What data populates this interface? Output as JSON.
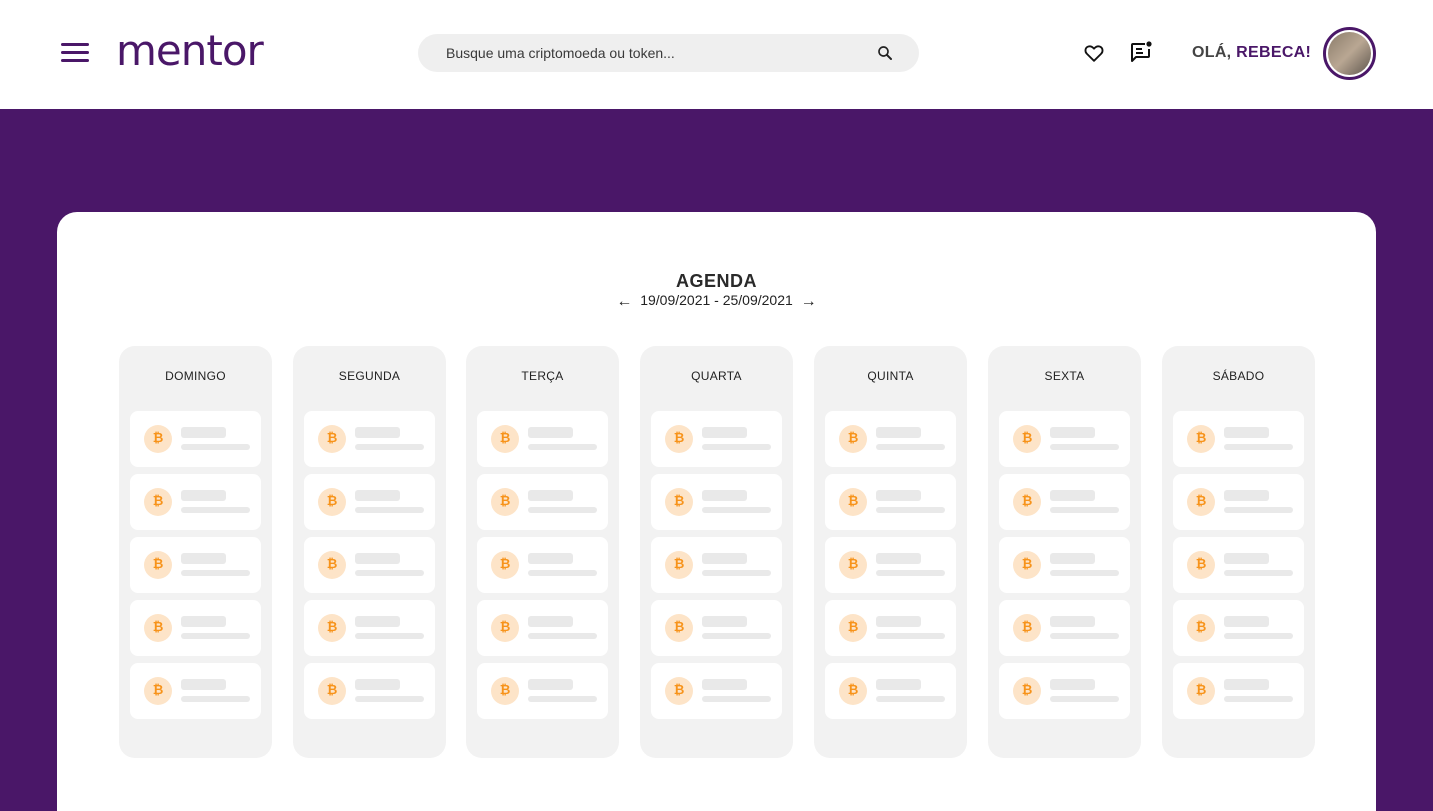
{
  "header": {
    "logo": "mentor",
    "search_placeholder": "Busque uma criptomoeda ou token...",
    "greeting_prefix": "OLÁ, ",
    "greeting_name": "REBECA!",
    "icons": [
      "menu-icon",
      "search-icon",
      "heart-icon",
      "chat-notification-icon"
    ]
  },
  "agenda": {
    "title": "AGENDA",
    "range": "19/09/2021 - 25/09/2021",
    "prev_arrow": "←",
    "next_arrow": "→",
    "days": [
      "DOMINGO",
      "SEGUNDA",
      "TERÇA",
      "QUARTA",
      "QUINTA",
      "SEXTA",
      "SÁBADO"
    ],
    "coin_symbol": "₿",
    "slots_per_day": 5
  },
  "colors": {
    "brand": "#4a1768",
    "coin": "#f7931a",
    "coin_bg": "#fde4c8",
    "column_bg": "#f2f2f2"
  }
}
